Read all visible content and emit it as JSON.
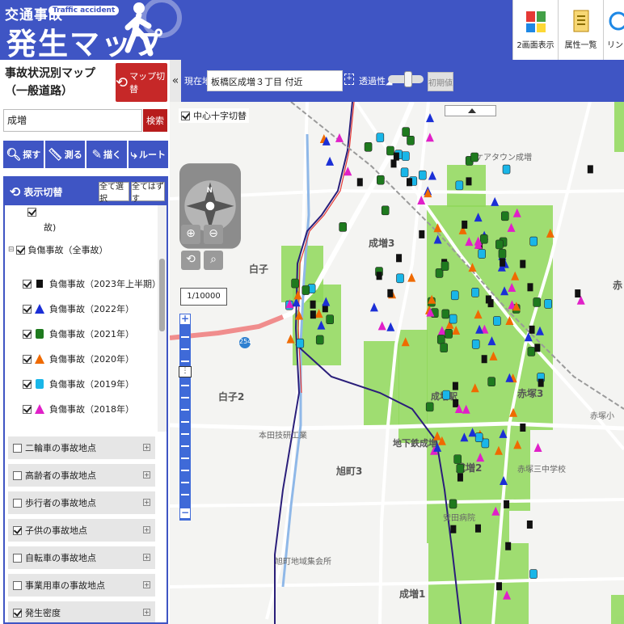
{
  "header": {
    "logo_line1": "交通事故",
    "logo_en": "Traffic accident",
    "logo_line2": "発生マップ",
    "tools": [
      {
        "label": "2画面表示",
        "icon": "dual-view-icon"
      },
      {
        "label": "属性一覧",
        "icon": "attribute-list-icon"
      },
      {
        "label": "リン",
        "icon": "link-icon"
      }
    ]
  },
  "sidebar": {
    "map_title": "事故状況別マップ（一般道路）",
    "map_switch_label": "マップ切替",
    "search_value": "成増",
    "search_button": "検索",
    "tools": [
      {
        "label": "探す",
        "icon": "search-icon"
      },
      {
        "label": "測る",
        "icon": "ruler-icon"
      },
      {
        "label": "描く",
        "icon": "draw-icon"
      },
      {
        "label": "ルート",
        "icon": "route-icon"
      }
    ],
    "layer_panel": {
      "title": "表示切替",
      "select_all": "全て選択",
      "clear_all": "全てはずす",
      "partial_top": "故)",
      "group_label": "負傷事故（全事故）",
      "items": [
        {
          "label": "負傷事故（2023年上半期）",
          "marker": "square",
          "color": "#111111"
        },
        {
          "label": "負傷事故（2022年）",
          "marker": "triangle",
          "color": "#1b2fd6"
        },
        {
          "label": "負傷事故（2021年）",
          "marker": "rounded",
          "color": "#1e7a1e"
        },
        {
          "label": "負傷事故（2020年）",
          "marker": "triangle",
          "color": "#ef6a00"
        },
        {
          "label": "負傷事故（2019年）",
          "marker": "rounded",
          "color": "#19b6e8"
        },
        {
          "label": "負傷事故（2018年）",
          "marker": "triangle",
          "color": "#e020c8"
        }
      ],
      "categories": [
        {
          "label": "二輪車の事故地点",
          "checked": false
        },
        {
          "label": "高齢者の事故地点",
          "checked": false
        },
        {
          "label": "歩行者の事故地点",
          "checked": false
        },
        {
          "label": "子供の事故地点",
          "checked": true
        },
        {
          "label": "自転車の事故地点",
          "checked": false
        },
        {
          "label": "事業用車の事故地点",
          "checked": false
        },
        {
          "label": "発生密度",
          "checked": true
        }
      ]
    }
  },
  "map_toolbar": {
    "location_label": "現在地",
    "location_value": "板橋区成増３丁目 付近",
    "opacity_label": "透過性",
    "opacity_level": 0.5,
    "reset_label": "初期値"
  },
  "map": {
    "crosshair_label": "中心十字切替",
    "scale": "1/10000",
    "compass_letter": "N",
    "labels": {
      "narimasu3": "成増3",
      "narimasu_st": "成増駅",
      "chika_narimasu": "地下鉄成増",
      "narimasu2": "成増2",
      "akatsuka3": "赤塚3",
      "shirako2": "白子2",
      "asahicho3": "旭町3",
      "narimasu1": "成増1",
      "akatsuka_short": "赤",
      "shirako_short": "白子",
      "route_no": "254",
      "akatsuka_school": "赤塚小",
      "sml1": "本田技研工業",
      "sml2": "安田病院",
      "sml3": "旭町地域集会所",
      "sml4": "赤塚三中学校",
      "sml5": "ケアタウン成増"
    }
  }
}
